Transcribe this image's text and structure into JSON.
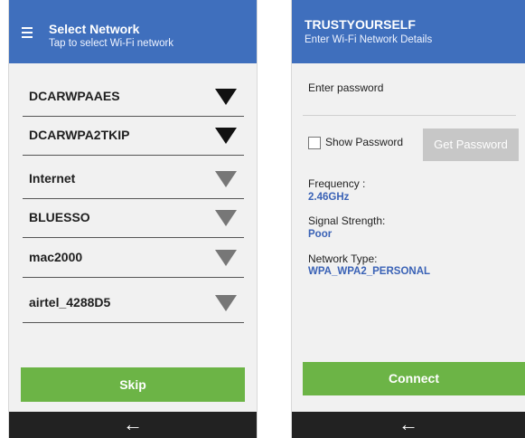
{
  "left_screen": {
    "header": {
      "title": "Select Network",
      "subtitle": "Tap to select Wi-Fi network"
    },
    "networks": [
      {
        "name": "DCARWPAAES",
        "signal_icon": "wifi-strong-icon"
      },
      {
        "name": "DCARWPA2TKIP",
        "signal_icon": "wifi-strong-icon"
      },
      {
        "name": "Internet",
        "signal_icon": "wifi-medium-icon"
      },
      {
        "name": "BLUESSO",
        "signal_icon": "wifi-medium-icon"
      },
      {
        "name": "mac2000",
        "signal_icon": "wifi-medium-icon"
      },
      {
        "name": "airtel_4288D5",
        "signal_icon": "wifi-medium-icon"
      }
    ],
    "skip_label": "Skip",
    "back_symbol": "←"
  },
  "right_screen": {
    "header": {
      "title": "TRUSTYOURSELF",
      "subtitle": "Enter Wi-Fi Network Details"
    },
    "password_label": "Enter password",
    "show_password_label": "Show Password",
    "get_password_label": "Get Password",
    "frequency_label": "Frequency :",
    "frequency_value": "2.46GHz",
    "signal_label": "Signal Strength:",
    "signal_value": "Poor",
    "network_type_label": "Network Type:",
    "network_type_value": "WPA_WPA2_PERSONAL",
    "connect_label": "Connect",
    "back_symbol": "←"
  },
  "colors": {
    "header": "#3f6fbd",
    "button_green": "#6cb446",
    "button_gray": "#c7c7c7",
    "value_blue": "#3a62b6",
    "navbar": "#222222"
  }
}
